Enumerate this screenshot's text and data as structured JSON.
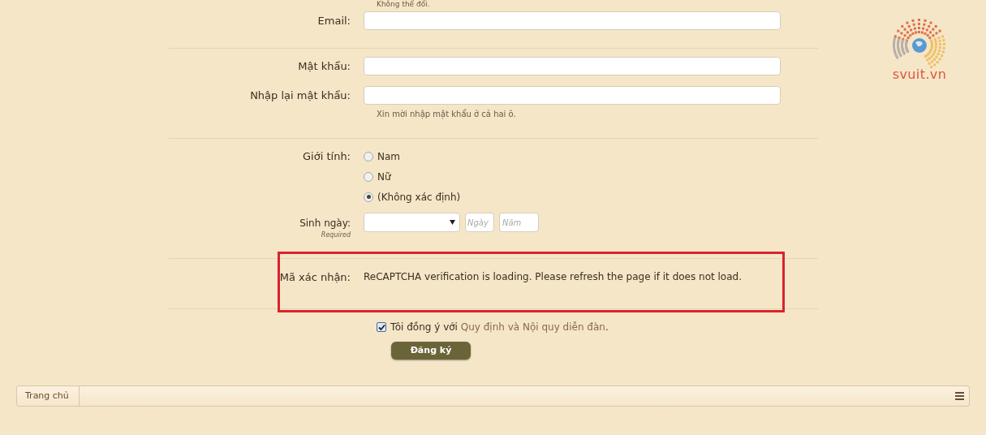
{
  "top_hint": "Không thể đổi.",
  "email": {
    "label": "Email:"
  },
  "password": {
    "label": "Mật khẩu:"
  },
  "password_confirm": {
    "label": "Nhập lại mật khẩu:",
    "hint": "Xin mời nhập mật khẩu ở cả hai ô."
  },
  "gender": {
    "label": "Giới tính:",
    "options": [
      {
        "label": "Nam",
        "selected": false
      },
      {
        "label": "Nữ",
        "selected": false
      },
      {
        "label": "(Không xác định)",
        "selected": true
      }
    ]
  },
  "birthday": {
    "label": "Sinh ngày:",
    "note": "Required",
    "day_placeholder": "Ngày",
    "year_placeholder": "Năm"
  },
  "captcha": {
    "label": "Mã xác nhận:",
    "message": "ReCAPTCHA verification is loading. Please refresh the page if it does not load.",
    "highlighted": true
  },
  "agree": {
    "checked": true,
    "text": "Tôi đồng ý với",
    "link": "Quy định và Nội quy diễn đàn",
    "after": "."
  },
  "submit": "Đăng ký",
  "logo": "svuit.vn",
  "breadcrumb": [
    {
      "label": "Trang chủ"
    }
  ]
}
